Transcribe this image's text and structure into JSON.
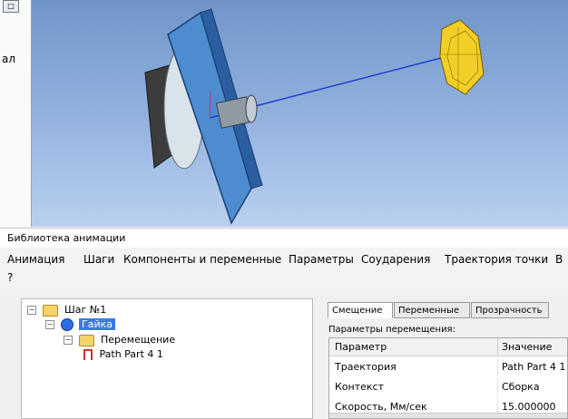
{
  "left_panel": {
    "label": "ал",
    "tool_icon": "window-icon"
  },
  "panel": {
    "title": "Библиотека анимации"
  },
  "menu": {
    "items": [
      "Анимация",
      "Шаги",
      "Компоненты и переменные",
      "Параметры",
      "Соударения",
      "Траектория точки",
      "В"
    ],
    "help": "?"
  },
  "tree": {
    "step": "Шаг №1",
    "part": "Гайка",
    "movement": "Перемещение",
    "path": "Path Part 4 1"
  },
  "tabs": [
    "Смещение",
    "Переменные",
    "Прозрачность"
  ],
  "params": {
    "caption": "Параметры перемещения:",
    "col_param": "Параметр",
    "col_value": "Значение",
    "rows": [
      {
        "param": "Траектория",
        "value": "Path Part 4 1"
      },
      {
        "param": "Контекст",
        "value": "Сборка"
      },
      {
        "param": "Скорость, Мм/сек",
        "value": "15.000000"
      }
    ]
  },
  "colors": {
    "viewport_top": "#6f95c8",
    "selection": "#3b7be1",
    "nut": "#f2cf28",
    "path_line": "#1d3fcf"
  }
}
